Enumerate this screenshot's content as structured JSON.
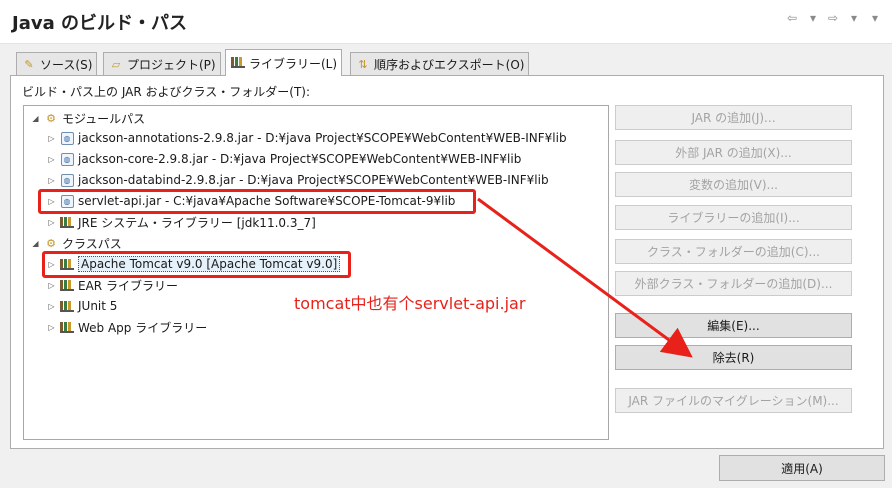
{
  "header": {
    "title": "Java のビルド・パス",
    "nav_back_icon": "⇦",
    "nav_fwd_icon": "⇨",
    "dropdown_icon": "▾",
    "menu_icon": "▾"
  },
  "tabs": [
    {
      "label": "ソース(S)",
      "icon": "source-folder-icon"
    },
    {
      "label": "プロジェクト(P)",
      "icon": "project-icon"
    },
    {
      "label": "ライブラリー(L)",
      "icon": "library-icon",
      "active": true
    },
    {
      "label": "順序およびエクスポート(O)",
      "icon": "order-export-icon"
    }
  ],
  "list_label": "ビルド・パス上の JAR およびクラス・フォルダー(T):",
  "tree": {
    "modulepath": {
      "label": "モジュールパス",
      "items": [
        "jackson-annotations-2.9.8.jar - D:¥java Project¥SCOPE¥WebContent¥WEB-INF¥lib",
        "jackson-core-2.9.8.jar - D:¥java Project¥SCOPE¥WebContent¥WEB-INF¥lib",
        "jackson-databind-2.9.8.jar - D:¥java Project¥SCOPE¥WebContent¥WEB-INF¥lib",
        "servlet-api.jar - C:¥java¥Apache Software¥SCOPE-Tomcat-9¥lib",
        "JRE システム・ライブラリー [jdk11.0.3_7]"
      ]
    },
    "classpath": {
      "label": "クラスパス",
      "items": [
        "Apache Tomcat v9.0 [Apache Tomcat v9.0]",
        "EAR ライブラリー",
        "JUnit 5",
        "Web App ライブラリー"
      ]
    }
  },
  "buttons": {
    "add_jar": "JAR の追加(J)...",
    "add_external_jar": "外部 JAR の追加(X)...",
    "add_variable": "変数の追加(V)...",
    "add_library": "ライブラリーの追加(I)...",
    "add_class_folder": "クラス・フォルダーの追加(C)...",
    "add_external_class_folder": "外部クラス・フォルダーの追加(D)...",
    "edit": "編集(E)...",
    "remove": "除去(R)",
    "migrate_jar": "JAR ファイルのマイグレーション(M)..."
  },
  "apply": "適用(A)",
  "annotation": {
    "text": "tomcat中也有个servlet-api.jar",
    "color": "#e8211a"
  }
}
